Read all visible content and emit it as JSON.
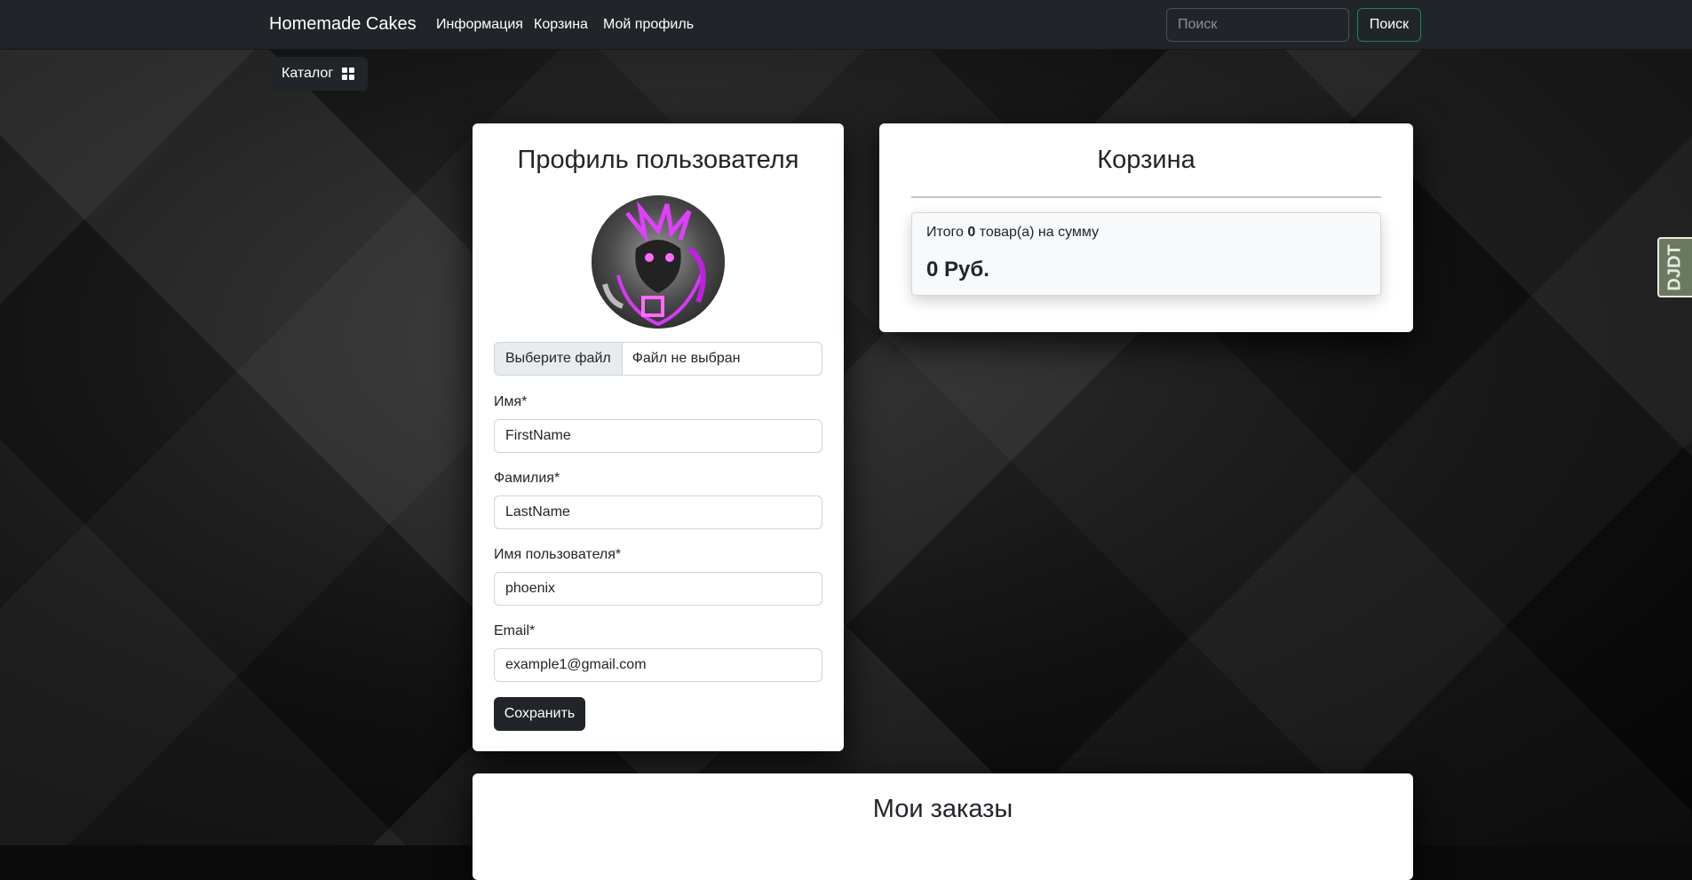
{
  "navbar": {
    "brand": "Homemade Cakes",
    "links": [
      "Информация",
      "Корзина",
      "Мой профиль"
    ],
    "search_placeholder": "Поиск",
    "search_button": "Поиск"
  },
  "catalog_button": "Каталог",
  "profile": {
    "title": "Профиль пользователя",
    "file_button": "Выберите файл",
    "file_status": "Файл не выбран",
    "fields": [
      {
        "label": "Имя*",
        "value": "FirstName"
      },
      {
        "label": "Фамилия*",
        "value": "LastName"
      },
      {
        "label": "Имя пользователя*",
        "value": "phoenix"
      },
      {
        "label": "Email*",
        "value": "example1@gmail.com"
      }
    ],
    "save_button": "Сохранить"
  },
  "cart": {
    "title": "Корзина",
    "summary_prefix": "Итого",
    "item_count": "0",
    "summary_suffix": "товар(а) на сумму",
    "total": "0 Руб."
  },
  "orders": {
    "title": "Мои заказы"
  },
  "debug_toolbar": {
    "label": "DJDT"
  },
  "colors": {
    "navbar": "#212529",
    "accent_green": "#198754",
    "avatar_glow": "#e040fb"
  }
}
